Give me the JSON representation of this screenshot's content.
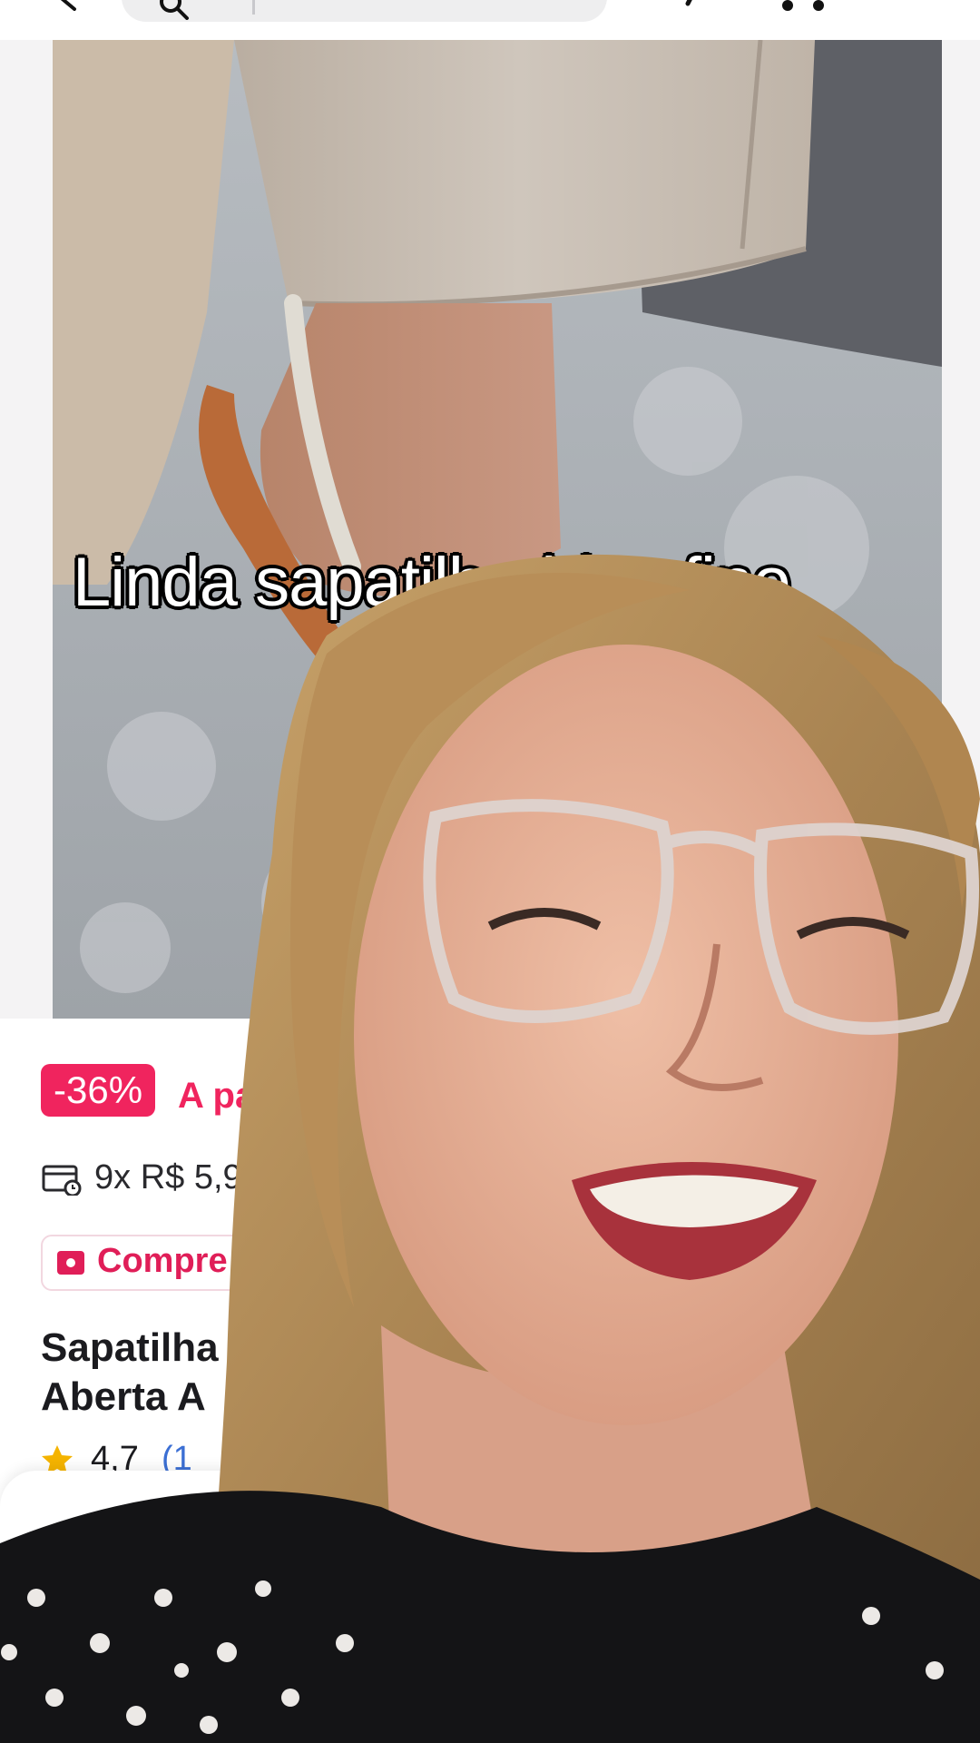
{
  "header": {
    "search_placeholder": "",
    "icons": [
      "back-arrow-icon",
      "search-icon",
      "share-icon",
      "cart-icon"
    ]
  },
  "video": {
    "caption": "Linda sapatilha bico fino"
  },
  "product": {
    "discount_badge": "-36%",
    "price_prefix": "A pa",
    "installments": "9x R$ 5,9",
    "promo_label": "Compre l",
    "title_line1": "Sapatilha",
    "title_line2": "Aberta A",
    "rating": "4,7",
    "reviews": "(1"
  },
  "colors": {
    "accent": "#f0245e",
    "link": "#3b6fd4"
  }
}
